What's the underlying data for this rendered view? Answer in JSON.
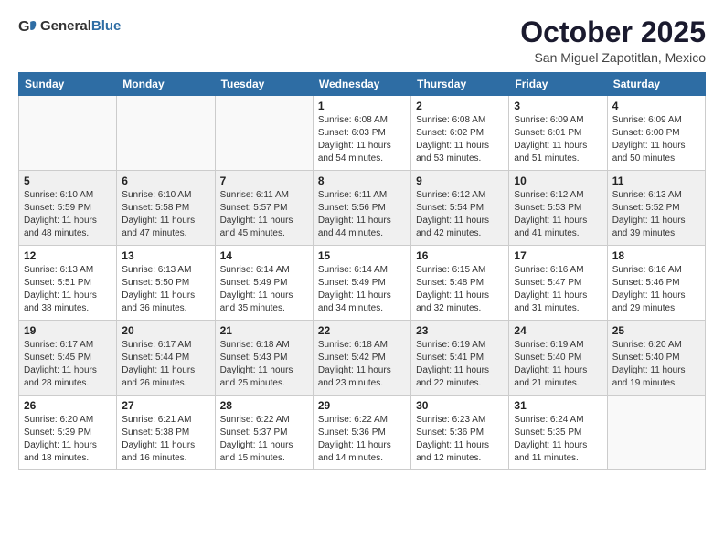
{
  "logo": {
    "general": "General",
    "blue": "Blue"
  },
  "title": "October 2025",
  "location": "San Miguel Zapotitlan, Mexico",
  "headers": [
    "Sunday",
    "Monday",
    "Tuesday",
    "Wednesday",
    "Thursday",
    "Friday",
    "Saturday"
  ],
  "weeks": [
    [
      {
        "day": "",
        "info": ""
      },
      {
        "day": "",
        "info": ""
      },
      {
        "day": "",
        "info": ""
      },
      {
        "day": "1",
        "info": "Sunrise: 6:08 AM\nSunset: 6:03 PM\nDaylight: 11 hours\nand 54 minutes."
      },
      {
        "day": "2",
        "info": "Sunrise: 6:08 AM\nSunset: 6:02 PM\nDaylight: 11 hours\nand 53 minutes."
      },
      {
        "day": "3",
        "info": "Sunrise: 6:09 AM\nSunset: 6:01 PM\nDaylight: 11 hours\nand 51 minutes."
      },
      {
        "day": "4",
        "info": "Sunrise: 6:09 AM\nSunset: 6:00 PM\nDaylight: 11 hours\nand 50 minutes."
      }
    ],
    [
      {
        "day": "5",
        "info": "Sunrise: 6:10 AM\nSunset: 5:59 PM\nDaylight: 11 hours\nand 48 minutes."
      },
      {
        "day": "6",
        "info": "Sunrise: 6:10 AM\nSunset: 5:58 PM\nDaylight: 11 hours\nand 47 minutes."
      },
      {
        "day": "7",
        "info": "Sunrise: 6:11 AM\nSunset: 5:57 PM\nDaylight: 11 hours\nand 45 minutes."
      },
      {
        "day": "8",
        "info": "Sunrise: 6:11 AM\nSunset: 5:56 PM\nDaylight: 11 hours\nand 44 minutes."
      },
      {
        "day": "9",
        "info": "Sunrise: 6:12 AM\nSunset: 5:54 PM\nDaylight: 11 hours\nand 42 minutes."
      },
      {
        "day": "10",
        "info": "Sunrise: 6:12 AM\nSunset: 5:53 PM\nDaylight: 11 hours\nand 41 minutes."
      },
      {
        "day": "11",
        "info": "Sunrise: 6:13 AM\nSunset: 5:52 PM\nDaylight: 11 hours\nand 39 minutes."
      }
    ],
    [
      {
        "day": "12",
        "info": "Sunrise: 6:13 AM\nSunset: 5:51 PM\nDaylight: 11 hours\nand 38 minutes."
      },
      {
        "day": "13",
        "info": "Sunrise: 6:13 AM\nSunset: 5:50 PM\nDaylight: 11 hours\nand 36 minutes."
      },
      {
        "day": "14",
        "info": "Sunrise: 6:14 AM\nSunset: 5:49 PM\nDaylight: 11 hours\nand 35 minutes."
      },
      {
        "day": "15",
        "info": "Sunrise: 6:14 AM\nSunset: 5:49 PM\nDaylight: 11 hours\nand 34 minutes."
      },
      {
        "day": "16",
        "info": "Sunrise: 6:15 AM\nSunset: 5:48 PM\nDaylight: 11 hours\nand 32 minutes."
      },
      {
        "day": "17",
        "info": "Sunrise: 6:16 AM\nSunset: 5:47 PM\nDaylight: 11 hours\nand 31 minutes."
      },
      {
        "day": "18",
        "info": "Sunrise: 6:16 AM\nSunset: 5:46 PM\nDaylight: 11 hours\nand 29 minutes."
      }
    ],
    [
      {
        "day": "19",
        "info": "Sunrise: 6:17 AM\nSunset: 5:45 PM\nDaylight: 11 hours\nand 28 minutes."
      },
      {
        "day": "20",
        "info": "Sunrise: 6:17 AM\nSunset: 5:44 PM\nDaylight: 11 hours\nand 26 minutes."
      },
      {
        "day": "21",
        "info": "Sunrise: 6:18 AM\nSunset: 5:43 PM\nDaylight: 11 hours\nand 25 minutes."
      },
      {
        "day": "22",
        "info": "Sunrise: 6:18 AM\nSunset: 5:42 PM\nDaylight: 11 hours\nand 23 minutes."
      },
      {
        "day": "23",
        "info": "Sunrise: 6:19 AM\nSunset: 5:41 PM\nDaylight: 11 hours\nand 22 minutes."
      },
      {
        "day": "24",
        "info": "Sunrise: 6:19 AM\nSunset: 5:40 PM\nDaylight: 11 hours\nand 21 minutes."
      },
      {
        "day": "25",
        "info": "Sunrise: 6:20 AM\nSunset: 5:40 PM\nDaylight: 11 hours\nand 19 minutes."
      }
    ],
    [
      {
        "day": "26",
        "info": "Sunrise: 6:20 AM\nSunset: 5:39 PM\nDaylight: 11 hours\nand 18 minutes."
      },
      {
        "day": "27",
        "info": "Sunrise: 6:21 AM\nSunset: 5:38 PM\nDaylight: 11 hours\nand 16 minutes."
      },
      {
        "day": "28",
        "info": "Sunrise: 6:22 AM\nSunset: 5:37 PM\nDaylight: 11 hours\nand 15 minutes."
      },
      {
        "day": "29",
        "info": "Sunrise: 6:22 AM\nSunset: 5:36 PM\nDaylight: 11 hours\nand 14 minutes."
      },
      {
        "day": "30",
        "info": "Sunrise: 6:23 AM\nSunset: 5:36 PM\nDaylight: 11 hours\nand 12 minutes."
      },
      {
        "day": "31",
        "info": "Sunrise: 6:24 AM\nSunset: 5:35 PM\nDaylight: 11 hours\nand 11 minutes."
      },
      {
        "day": "",
        "info": ""
      }
    ]
  ]
}
